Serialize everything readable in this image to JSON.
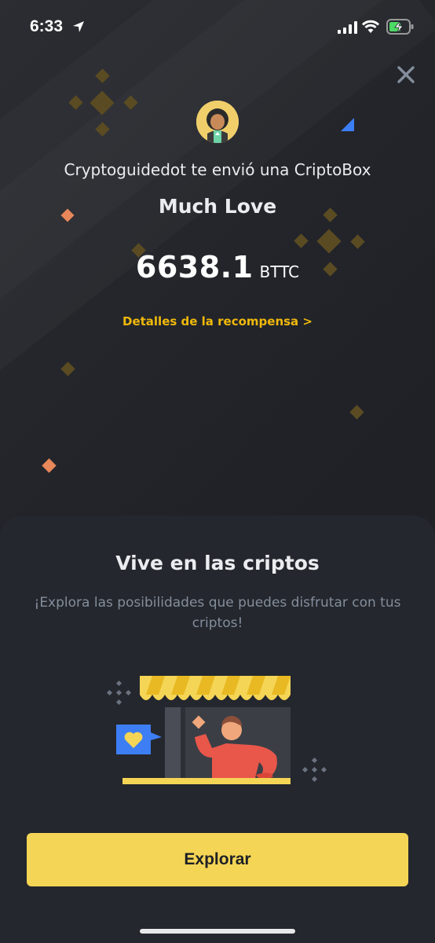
{
  "status_bar": {
    "time": "6:33"
  },
  "gift": {
    "sender_line": "Cryptoguidedot te envió una CriptoBox",
    "title": "Much Love",
    "amount": "6638.1",
    "unit": "BTTC",
    "details_link": "Detalles de la recompensa >"
  },
  "promo": {
    "title": "Vive en las criptos",
    "description": "¡Explora las posibilidades que puedes disfrutar con tus criptos!",
    "button_label": "Explorar"
  },
  "colors": {
    "accent_yellow": "#f0b90b",
    "button_yellow": "#f5d555",
    "background": "#1f2127",
    "sheet": "#24272d",
    "muted_text": "#848e9c"
  },
  "icons": [
    "location-arrow-icon",
    "signal-icon",
    "wifi-icon",
    "battery-charging-icon",
    "close-icon",
    "heart-speech-bubble-icon"
  ]
}
